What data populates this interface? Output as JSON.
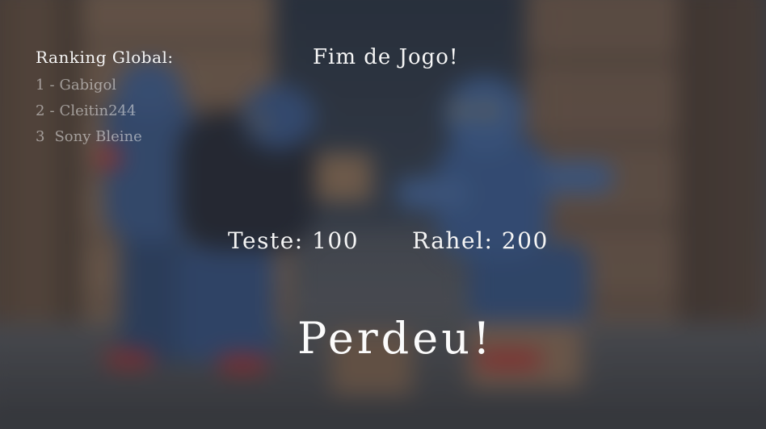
{
  "ranking": {
    "title": "Ranking Global:",
    "entries": [
      {
        "pos": "1",
        "sep": "-",
        "name": "Gabigol"
      },
      {
        "pos": "2",
        "sep": "-",
        "name": "Cleitin244"
      },
      {
        "pos": "3",
        "sep": "",
        "name": "Sony Bleine"
      }
    ]
  },
  "game_over": {
    "title": "Fim de Jogo!",
    "result": "Perdeu!"
  },
  "scores": [
    {
      "player": "Teste",
      "points": "100",
      "text": "Teste: 100"
    },
    {
      "player": "Rahel",
      "points": "200",
      "text": "Rahel: 200"
    }
  ],
  "colors": {
    "text": "#f4f4f4",
    "ranking_faded": "#ebebeb",
    "overlay": "#14182066"
  }
}
